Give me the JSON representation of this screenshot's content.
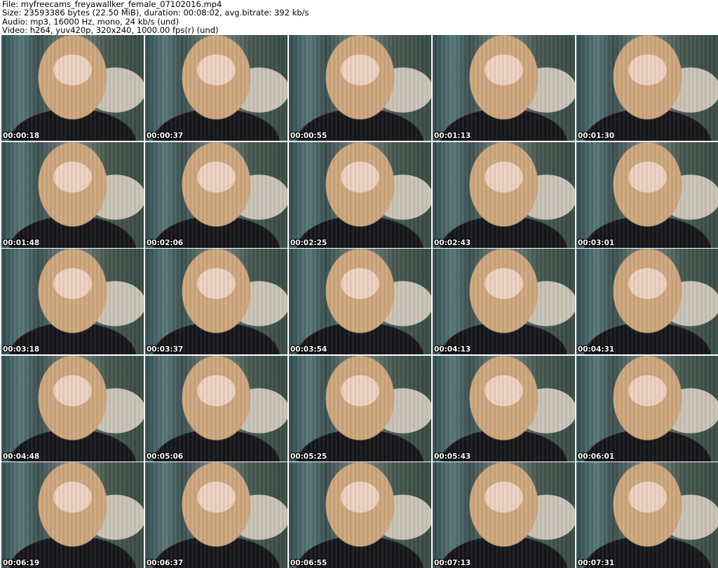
{
  "header": {
    "file_line": "File: myfreecams_freyawallker_female_07102016.mp4",
    "size_line": "Size: 23593386 bytes (22.50 MiB), duration: 00:08:02, avg.bitrate: 392 kb/s",
    "audio_line": "Audio: mp3, 16000 Hz, mono, 24 kb/s (und)",
    "video_line": "Video: h264, yuv420p, 320x240, 1000.00 fps(r) (und)"
  },
  "thumbnails": [
    {
      "timestamp": "00:00:18"
    },
    {
      "timestamp": "00:00:37"
    },
    {
      "timestamp": "00:00:55"
    },
    {
      "timestamp": "00:01:13"
    },
    {
      "timestamp": "00:01:30"
    },
    {
      "timestamp": "00:01:48"
    },
    {
      "timestamp": "00:02:06"
    },
    {
      "timestamp": "00:02:25"
    },
    {
      "timestamp": "00:02:43"
    },
    {
      "timestamp": "00:03:01"
    },
    {
      "timestamp": "00:03:18"
    },
    {
      "timestamp": "00:03:37"
    },
    {
      "timestamp": "00:03:54"
    },
    {
      "timestamp": "00:04:13"
    },
    {
      "timestamp": "00:04:31"
    },
    {
      "timestamp": "00:04:48"
    },
    {
      "timestamp": "00:05:06"
    },
    {
      "timestamp": "00:05:25"
    },
    {
      "timestamp": "00:05:43"
    },
    {
      "timestamp": "00:06:01"
    },
    {
      "timestamp": "00:06:19"
    },
    {
      "timestamp": "00:06:37"
    },
    {
      "timestamp": "00:06:55"
    },
    {
      "timestamp": "00:07:13"
    },
    {
      "timestamp": "00:07:31"
    }
  ]
}
